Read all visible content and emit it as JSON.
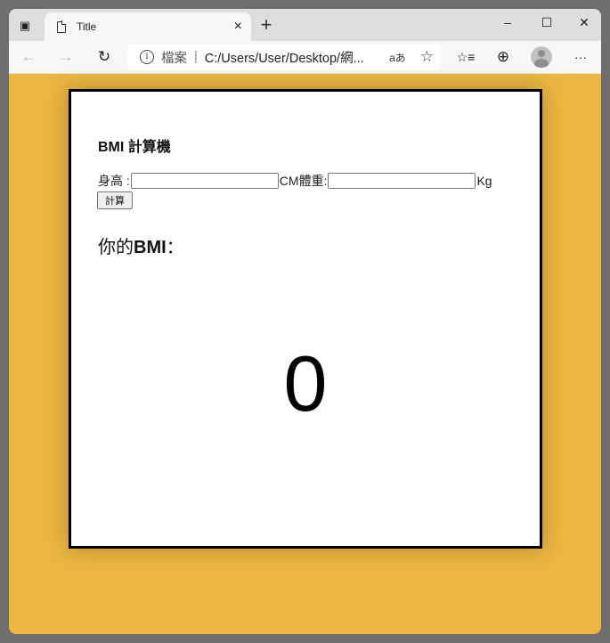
{
  "browser": {
    "tab_title": "Title",
    "tab_close": "×",
    "new_tab": "+",
    "minimize": "–",
    "maximize": "☐",
    "close_window": "✕",
    "back": "←",
    "forward": "→",
    "refresh": "↻",
    "info_icon": "i",
    "origin_label": "檔案",
    "url": "C:/Users/User/Desktop/網...",
    "read_aloud": "aあ",
    "favorites_star": "☆",
    "favorites": "☆≡",
    "collections": "⊕",
    "more": "···"
  },
  "page": {
    "heading_prefix": "BMI",
    "heading_suffix": " 計算機",
    "height_label": "身高 :",
    "height_unit": "CM",
    "weight_label": " 體重:",
    "weight_unit": "Kg",
    "height_value": "",
    "weight_value": "",
    "calculate_button": "計算",
    "result_label_prefix": "你的",
    "result_label_bold": "BMI",
    "result_label_suffix": "：",
    "result_value": "0"
  },
  "colors": {
    "page_background": "#ecb640",
    "card_background": "#ffffff",
    "card_border": "#000000"
  }
}
